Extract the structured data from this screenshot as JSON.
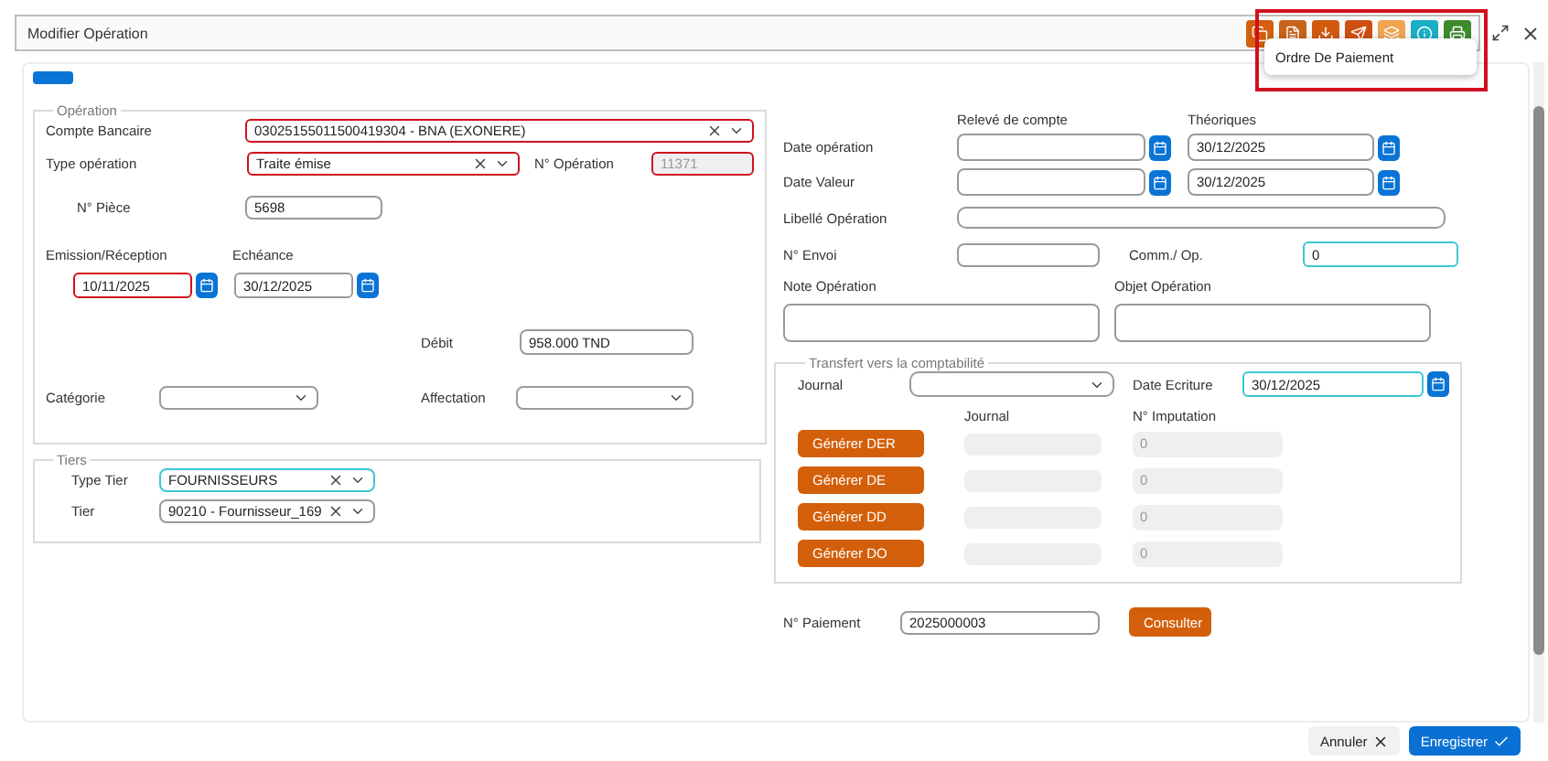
{
  "dialog": {
    "title": "Modifier Opération"
  },
  "toolbar": {
    "framed": true,
    "buttons": [
      {
        "color": "#d4600e"
      },
      {
        "color": "#c8631a"
      },
      {
        "color": "#d05a10"
      },
      {
        "color": "#cf4f12"
      },
      {
        "color": "#f0a451"
      },
      {
        "color": "#1aafc6"
      },
      {
        "color": "#3d8a2c"
      }
    ],
    "menu": {
      "items": [
        "Ordre De Paiement"
      ]
    }
  },
  "tabs": [
    {
      "selected": true
    }
  ],
  "operation": {
    "legend": "Opération",
    "compte_bancaire": {
      "label": "Compte Bancaire",
      "value": "03025155011500419304 - BNA (EXONERE)",
      "invalid": true
    },
    "type_operation": {
      "label": "Type opération",
      "value": "Traite émise",
      "invalid": true
    },
    "n_operation": {
      "label": "N° Opération",
      "value": "11371",
      "invalid": true,
      "disabled": true
    },
    "n_piece": {
      "label": "N° Pièce",
      "value": "5698"
    },
    "emission": {
      "label": "Emission/Réception",
      "value": "10/11/2025",
      "invalid": true
    },
    "echeance": {
      "label": "Echéance",
      "value": "30/12/2025"
    },
    "debit": {
      "label": "Débit",
      "value": "958.000 TND"
    },
    "categorie": {
      "label": "Catégorie"
    },
    "affectation": {
      "label": "Affectation"
    }
  },
  "tiers": {
    "legend": "Tiers",
    "type_tier": {
      "label": "Type Tier",
      "value": "FOURNISSEURS",
      "focused": true
    },
    "tier": {
      "label": "Tier",
      "value": "90210 - Fournisseur_169"
    }
  },
  "dates": {
    "releve_header": "Relevé de compte",
    "theoriques_header": "Théoriques",
    "rows": [
      {
        "label": "Date opération",
        "releve": {},
        "theorique": {
          "value": "30/12/2025"
        }
      },
      {
        "label": "Date Valeur",
        "releve": {},
        "theorique": {
          "value": "30/12/2025"
        }
      }
    ]
  },
  "libelle": {
    "label": "Libellé Opération"
  },
  "n_envoi": {
    "label": "N° Envoi"
  },
  "comm": {
    "label": "Comm./ Op.",
    "value": "0",
    "focused": true
  },
  "note": {
    "label": "Note Opération"
  },
  "objet": {
    "label": "Objet Opération"
  },
  "transfert": {
    "legend": "Transfert vers la comptabilité",
    "journal": {
      "label": "Journal"
    },
    "date_ecriture": {
      "label": "Date Ecriture",
      "value": "30/12/2025",
      "focused": true
    },
    "col_journal": "Journal",
    "col_imputation": "N° Imputation",
    "rows": [
      {
        "button": "Générer DER",
        "imputation": "0"
      },
      {
        "button": "Générer DE",
        "imputation": "0"
      },
      {
        "button": "Générer DD",
        "imputation": "0"
      },
      {
        "button": "Générer DO",
        "imputation": "0"
      }
    ]
  },
  "paiement": {
    "label": "N° Paiement",
    "value": "2025000003",
    "button": "Consulter"
  },
  "footer": {
    "cancel": "Annuler",
    "save": "Enregistrer"
  }
}
